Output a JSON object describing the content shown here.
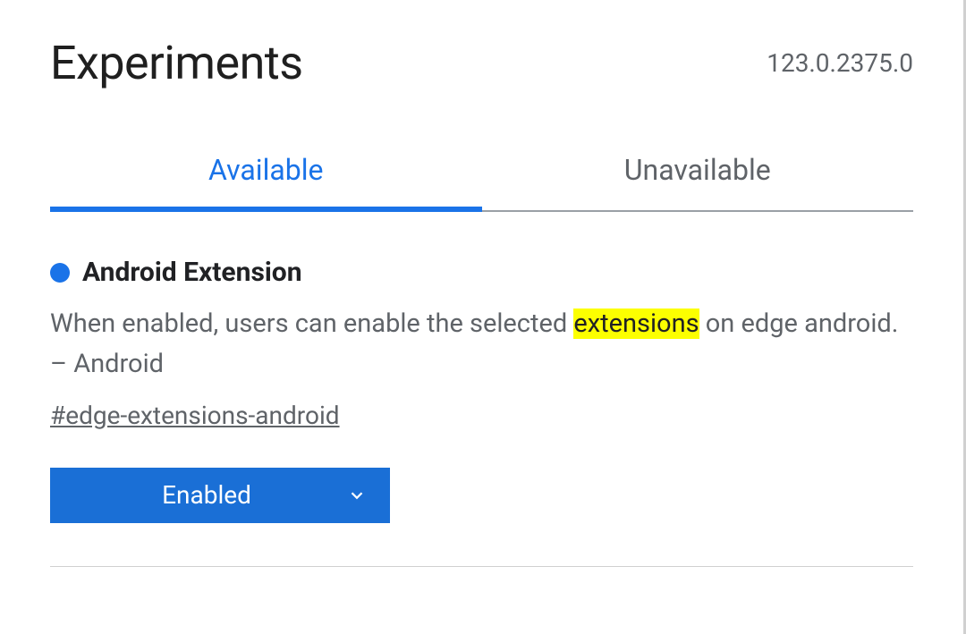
{
  "header": {
    "title": "Experiments",
    "version": "123.0.2375.0"
  },
  "tabs": {
    "available": "Available",
    "unavailable": "Unavailable"
  },
  "flag": {
    "title": "Android Extension",
    "desc_pre": "When enabled, users can enable the selected ",
    "desc_highlight": "extensions",
    "desc_post": " on edge android. – Android",
    "anchor": "#edge-extensions-android",
    "dropdown_value": "Enabled"
  }
}
